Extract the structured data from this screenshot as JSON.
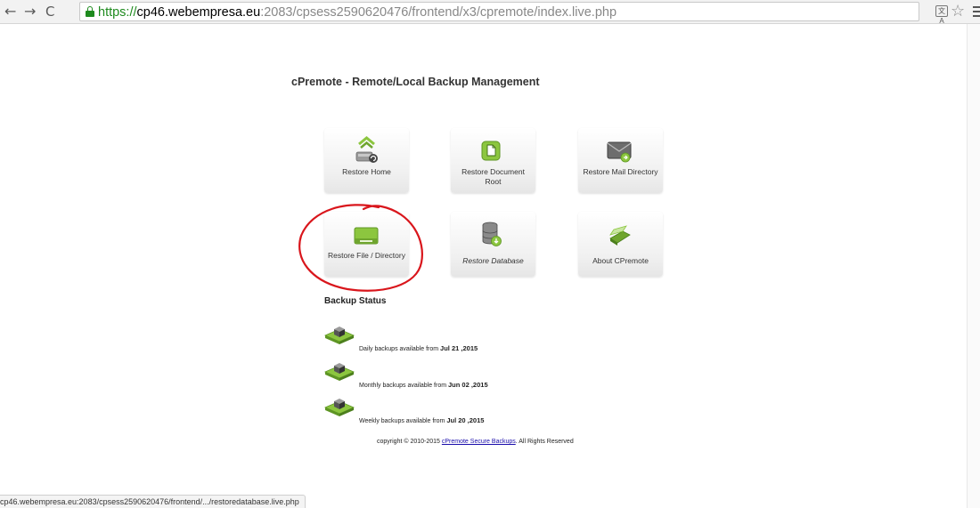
{
  "browser": {
    "url_protocol": "https://",
    "url_host": "cp46.webempresa.eu",
    "url_path": ":2083/cpsess2590620476/frontend/x3/cpremote/index.live.php",
    "back_icon": "←",
    "forward_icon": "→",
    "reload_icon": "C",
    "translate_label": "文A",
    "star_icon": "☆",
    "status_url": "cp46.webempresa.eu:2083/cpsess2590620476/frontend/.../restoredatabase.live.php"
  },
  "page": {
    "title": "cPremote - Remote/Local Backup Management"
  },
  "tiles": [
    {
      "label": "Restore Home",
      "icon": "home-restore-icon"
    },
    {
      "label": "Restore Document Root",
      "icon": "document-root-icon"
    },
    {
      "label": "Restore Mail Directory",
      "icon": "mail-directory-icon"
    },
    {
      "label": "Restore File / Directory",
      "icon": "file-directory-icon"
    },
    {
      "label": "Restore Database",
      "icon": "database-icon"
    },
    {
      "label": "About CPremote",
      "icon": "about-icon"
    }
  ],
  "backup_status": {
    "heading": "Backup Status",
    "rows": [
      {
        "prefix": "Daily backups available from ",
        "date": "Jul 21 ,2015"
      },
      {
        "prefix": "Monthly backups available from ",
        "date": "Jun 02 ,2015"
      },
      {
        "prefix": "Weekly backups available from ",
        "date": "Jul 20 ,2015"
      }
    ]
  },
  "footer": {
    "prefix": "copyright © 2010-2015 ",
    "link": "cPremote Secure Backups",
    "suffix": ". All Rights Reserved"
  },
  "colors": {
    "accent_green": "#8cc63f",
    "secure_green": "#1e8a1e",
    "annotation_red": "#d9161c"
  }
}
